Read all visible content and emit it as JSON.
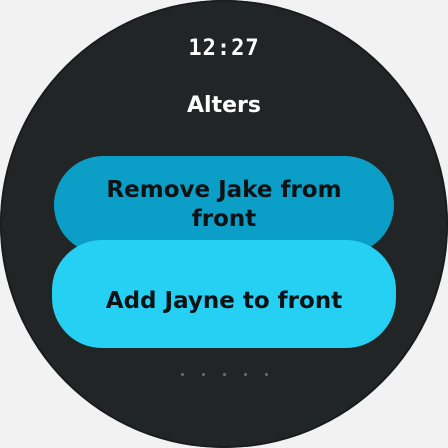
{
  "status_bar": {
    "time": "12:27"
  },
  "screen": {
    "title": "Alters"
  },
  "actions": {
    "remove_label": "Remove Jake from front",
    "add_label": "Add Jayne to front"
  },
  "colors": {
    "background": "#222526",
    "remove_chip": "#0b9ec6",
    "add_chip": "#25d0f3",
    "text_on_chip": "#0e1214"
  }
}
